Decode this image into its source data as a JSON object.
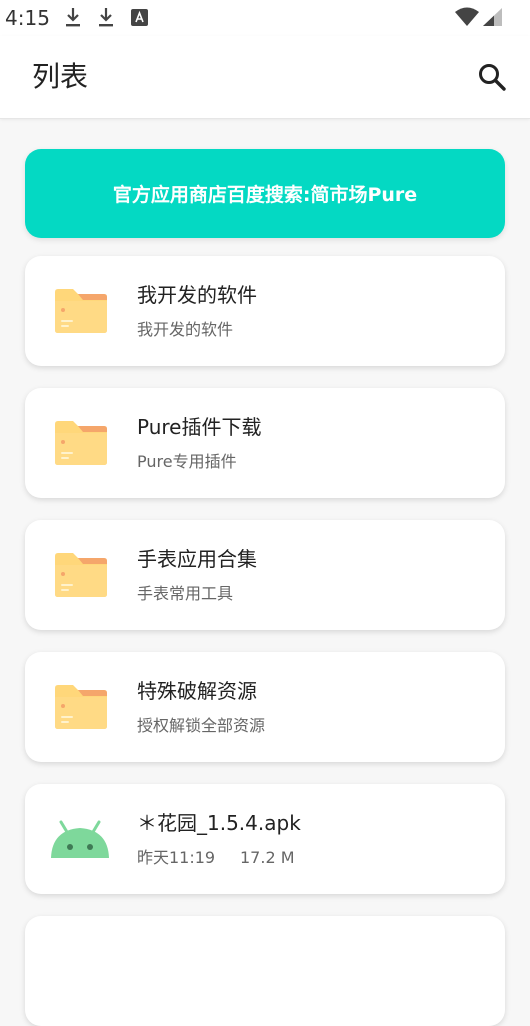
{
  "status_bar": {
    "time": "4:15",
    "icons": [
      "download-icon",
      "download-icon",
      "a11y-icon",
      "wifi-icon",
      "signal-icon"
    ]
  },
  "app_bar": {
    "title": "列表",
    "search_icon": "search-icon"
  },
  "banner": {
    "text": "官方应用商店百度搜索:简市场Pure",
    "color": "#04d9c3"
  },
  "items": [
    {
      "type": "folder",
      "title": "我开发的软件",
      "subtitle": "我开发的软件"
    },
    {
      "type": "folder",
      "title": "Pure插件下载",
      "subtitle": "Pure专用插件"
    },
    {
      "type": "folder",
      "title": "手表应用合集",
      "subtitle": "手表常用工具"
    },
    {
      "type": "folder",
      "title": "特殊破解资源",
      "subtitle": "授权解锁全部资源"
    },
    {
      "type": "apk",
      "title": "＊花园_1.5.4.apk",
      "date": "昨天11:19",
      "size": "17.2 M"
    }
  ],
  "colors": {
    "folder_body": "#ffd77a",
    "folder_tab": "#f5a66b",
    "android_green": "#7ed89b"
  }
}
